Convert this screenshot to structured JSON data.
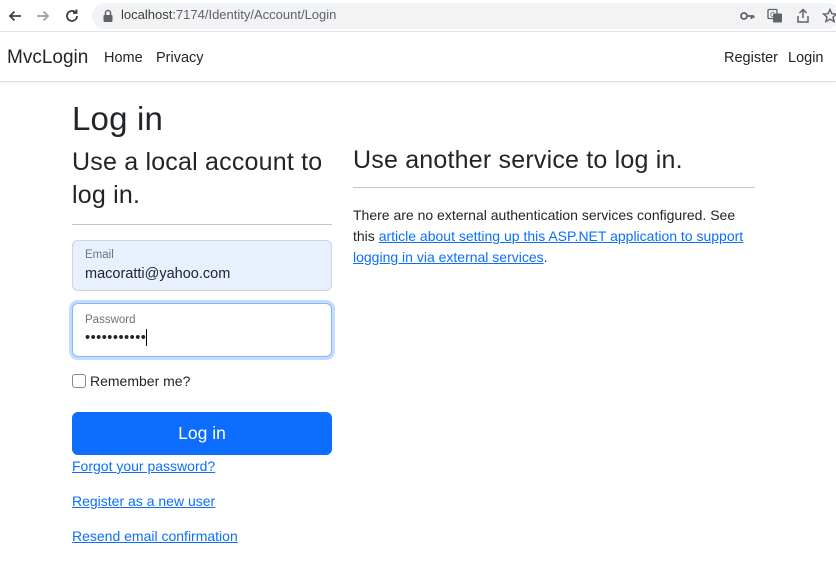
{
  "browser": {
    "url_host": "localhost",
    "url_path": ":7174/Identity/Account/Login"
  },
  "navbar": {
    "brand": "MvcLogin",
    "links": [
      "Home",
      "Privacy"
    ],
    "register": "Register",
    "login": "Login"
  },
  "page": {
    "title": "Log in",
    "local_heading": "Use a local account to log in.",
    "external_heading": "Use another service to log in."
  },
  "form": {
    "email_label": "Email",
    "email_value": "macoratti@yahoo.com",
    "password_label": "Password",
    "password_masked": "•••••••••••",
    "remember_label": "Remember me?",
    "submit_label": "Log in"
  },
  "links": {
    "forgot": "Forgot your password?",
    "register": "Register as a new user",
    "resend": "Resend email confirmation"
  },
  "external": {
    "text_before": "There are no external authentication services configured. See this",
    "link_text": "article about setting up this ASP.NET application to support logging in via external services",
    "text_after": "."
  },
  "colors": {
    "primary": "#0d6efd",
    "autofill": "#e8f0fe"
  },
  "icons": [
    "back-arrow-icon",
    "forward-arrow-icon",
    "reload-icon",
    "lock-icon",
    "key-icon",
    "translate-icon",
    "share-icon",
    "star-icon"
  ]
}
